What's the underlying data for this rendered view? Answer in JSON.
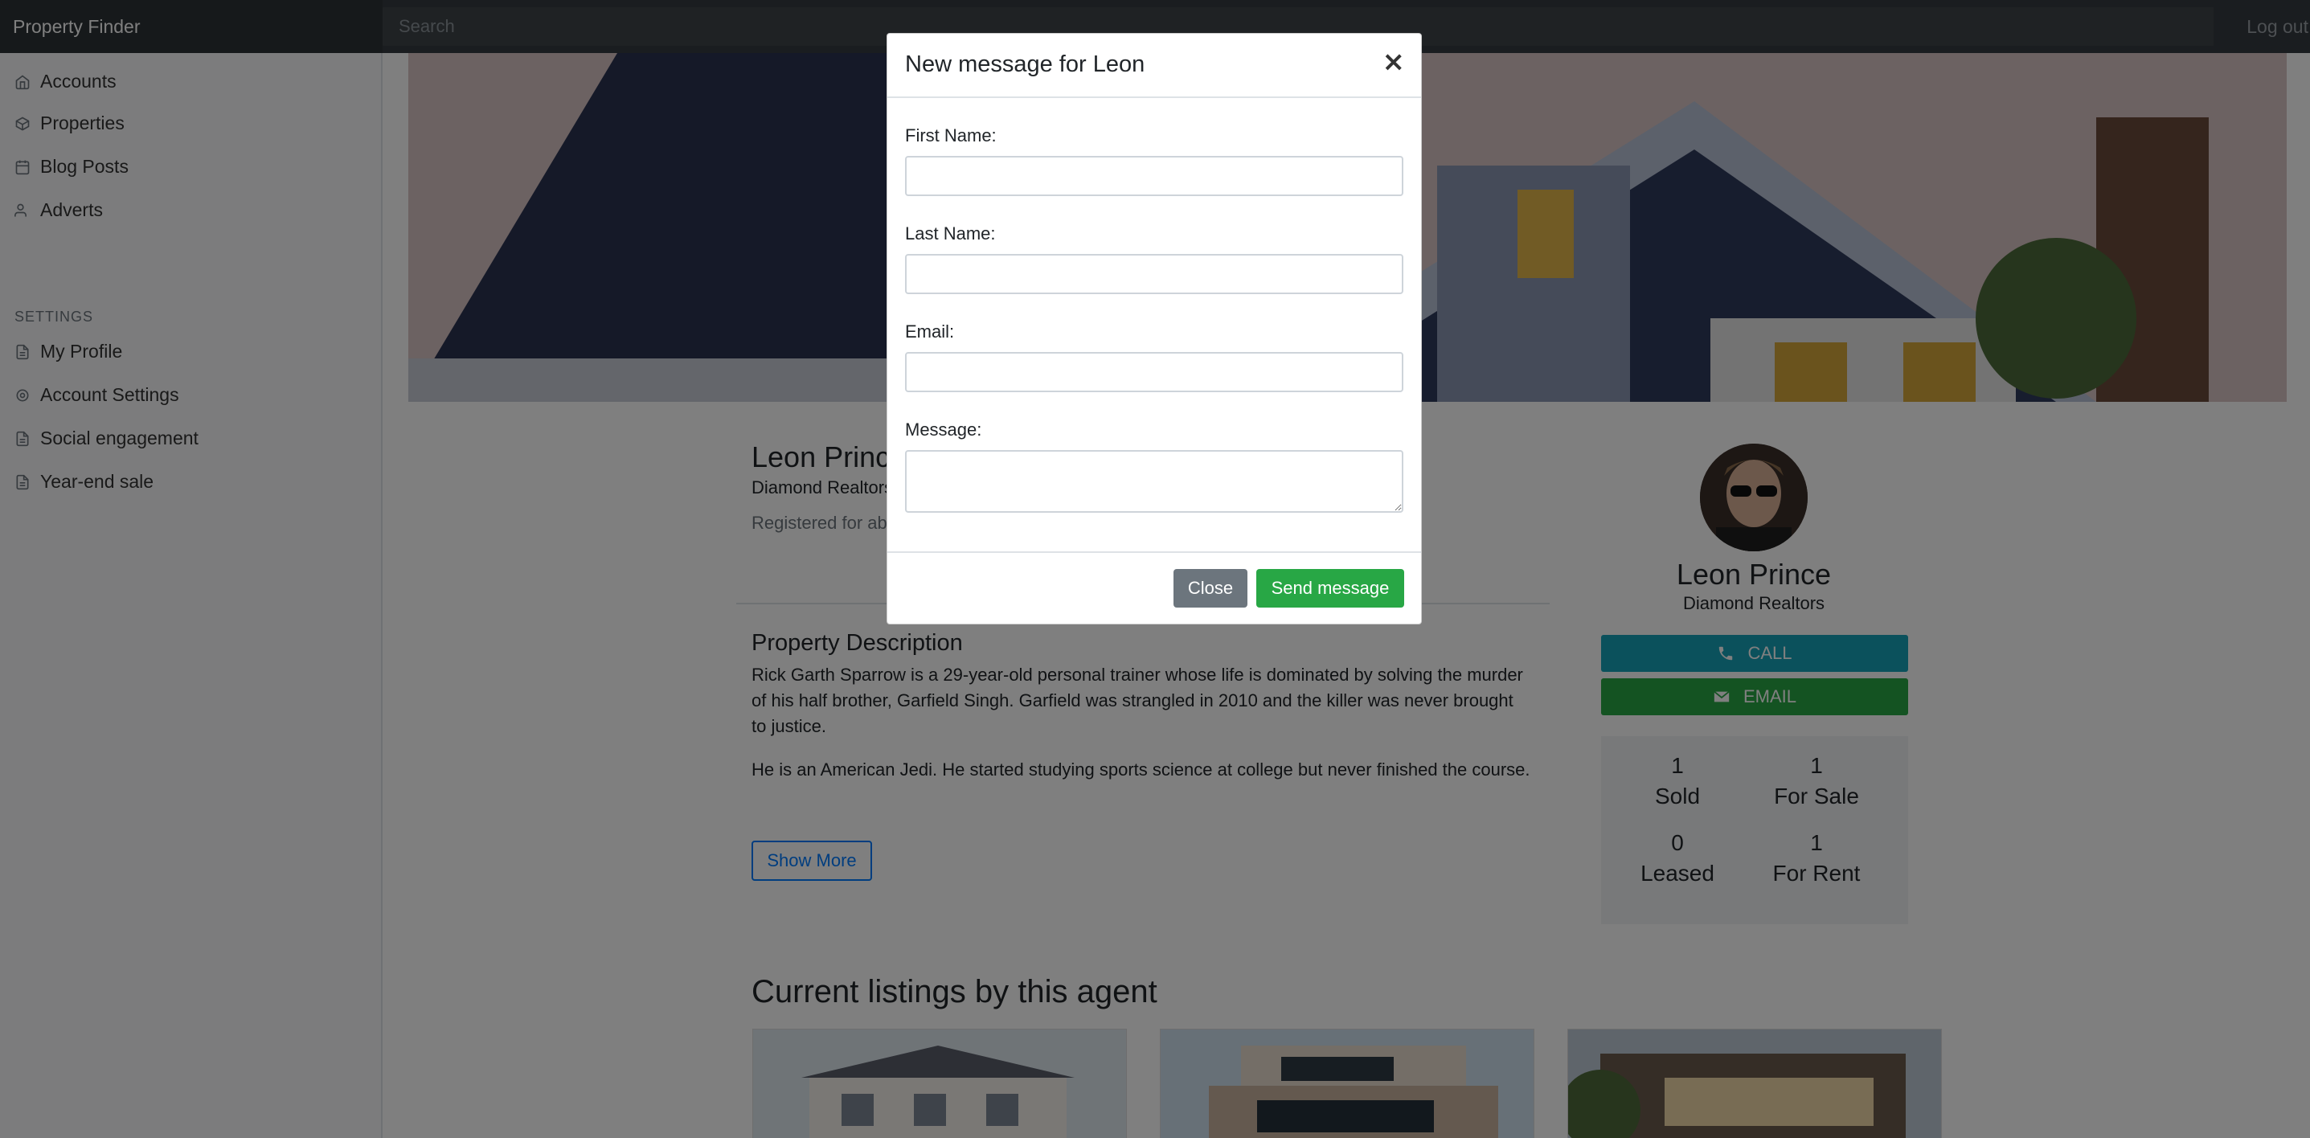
{
  "navbar": {
    "brand": "Property Finder",
    "search_placeholder": "Search",
    "logout": "Log out"
  },
  "sidebar": {
    "items": [
      {
        "label": "Accounts",
        "icon": "home-icon"
      },
      {
        "label": "Properties",
        "icon": "box-icon"
      },
      {
        "label": "Blog Posts",
        "icon": "calendar-icon"
      },
      {
        "label": "Adverts",
        "icon": "users-icon"
      }
    ],
    "settings_heading": "SETTINGS",
    "settings_items": [
      {
        "label": "My Profile",
        "icon": "file-icon"
      },
      {
        "label": "Account Settings",
        "icon": "gear-icon"
      },
      {
        "label": "Social engagement",
        "icon": "file-icon"
      },
      {
        "label": "Year-end sale",
        "icon": "file-icon"
      }
    ]
  },
  "agent": {
    "name": "Leon Prince",
    "company": "Diamond Realtors",
    "registered": "Registered for ab",
    "description_title": "Property Description",
    "description_p1": "Rick Garth Sparrow is a 29-year-old personal trainer whose life is dominated by solving the murder of his half brother, Garfield Singh. Garfield was strangled in 2010 and the killer was never brought to justice.",
    "description_p2": "He is an American Jedi. He started studying sports science at college but never finished the course.",
    "show_more": "Show More",
    "listings_title": "Current listings by this agent"
  },
  "card": {
    "name": "Leon Prince",
    "company": "Diamond Realtors",
    "call_label": "CALL",
    "email_label": "EMAIL",
    "stats": [
      {
        "value": "1",
        "label": "Sold"
      },
      {
        "value": "1",
        "label": "For Sale"
      },
      {
        "value": "0",
        "label": "Leased"
      },
      {
        "value": "1",
        "label": "For Rent"
      }
    ]
  },
  "modal": {
    "title": "New message for Leon",
    "close_x": "×",
    "first_name_label": "First Name:",
    "first_name_value": "",
    "last_name_label": "Last Name:",
    "last_name_value": "",
    "email_label": "Email:",
    "email_value": "",
    "message_label": "Message:",
    "message_value": "",
    "close_button": "Close",
    "send_button": "Send message"
  },
  "colors": {
    "navbar": "#343a40",
    "info": "#17a2b8",
    "success": "#28a745",
    "secondary": "#6c757d",
    "primary": "#007bff"
  }
}
